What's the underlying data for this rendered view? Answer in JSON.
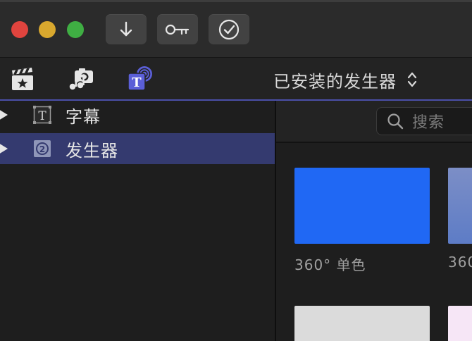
{
  "window": {
    "traffic_lights": [
      "close",
      "minimize",
      "zoom"
    ]
  },
  "toolbar": {
    "buttons": [
      {
        "name": "import",
        "icon": "down-arrow-icon"
      },
      {
        "name": "keywords",
        "icon": "key-icon"
      },
      {
        "name": "background-tasks",
        "icon": "checkmark-circle-icon"
      }
    ]
  },
  "browser_tabs": {
    "items": [
      {
        "name": "libraries",
        "icon": "clapperboard-icon"
      },
      {
        "name": "photos-audio",
        "icon": "camera-music-icon"
      },
      {
        "name": "titles-generators",
        "icon": "titles-generators-icon",
        "selected": true
      }
    ],
    "filter_label": "已安装的发生器"
  },
  "sidebar": {
    "items": [
      {
        "label": "字幕",
        "icon": "title-T-icon",
        "selected": false
      },
      {
        "label": "发生器",
        "icon": "generator-icon",
        "selected": true
      }
    ]
  },
  "search": {
    "placeholder": "搜索"
  },
  "tiles": [
    {
      "label": "360° 单色",
      "color": "#2068f4"
    },
    {
      "label": "360",
      "color": "#6b84c6"
    },
    {
      "label": "",
      "color": "#dbdbdb"
    },
    {
      "label": "",
      "color": "#f6e6f6"
    }
  ],
  "colors": {
    "accent": "#4b4fa8",
    "selection": "#343a6f",
    "tile_blue": "#2068f4"
  }
}
